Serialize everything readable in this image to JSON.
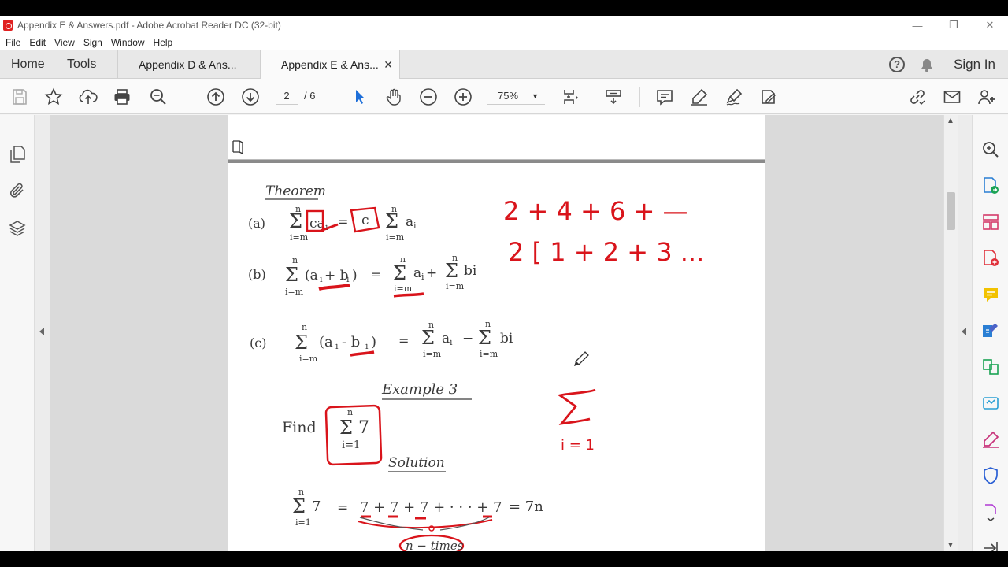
{
  "window": {
    "title": "Appendix E & Answers.pdf - Adobe Acrobat Reader DC (32-bit)",
    "minimize": "—",
    "restore": "❐",
    "close": "✕"
  },
  "menu": [
    "File",
    "Edit",
    "View",
    "Sign",
    "Window",
    "Help"
  ],
  "tabs": {
    "home": "Home",
    "tools": "Tools",
    "documents": [
      {
        "label": "Appendix D & Ans...",
        "active": false
      },
      {
        "label": "Appendix E & Ans...",
        "active": true
      }
    ],
    "close_glyph": "✕",
    "help_glyph": "?",
    "sign_in": "Sign In"
  },
  "toolbar": {
    "current_page": "2",
    "total_pages": "/ 6",
    "zoom": "75%",
    "zoom_caret": "▼"
  },
  "scrollbar": {
    "up": "▲",
    "down": "▼"
  },
  "document": {
    "heading": "Theorem",
    "parts": [
      "(a)",
      "(b)",
      "(c)"
    ],
    "example_title": "Example 3",
    "find_label": "Find",
    "solution_title": "Solution",
    "note_line1": "2 + 4 + 6 + —",
    "note_line2": "2 [ 1 + 2 + 3 ...",
    "n_times": "n − times",
    "result": "= 7n"
  },
  "colors": {
    "accent_red": "#d9141b",
    "ink": "#3a3a3a",
    "pdf_icon": "#e02020"
  }
}
